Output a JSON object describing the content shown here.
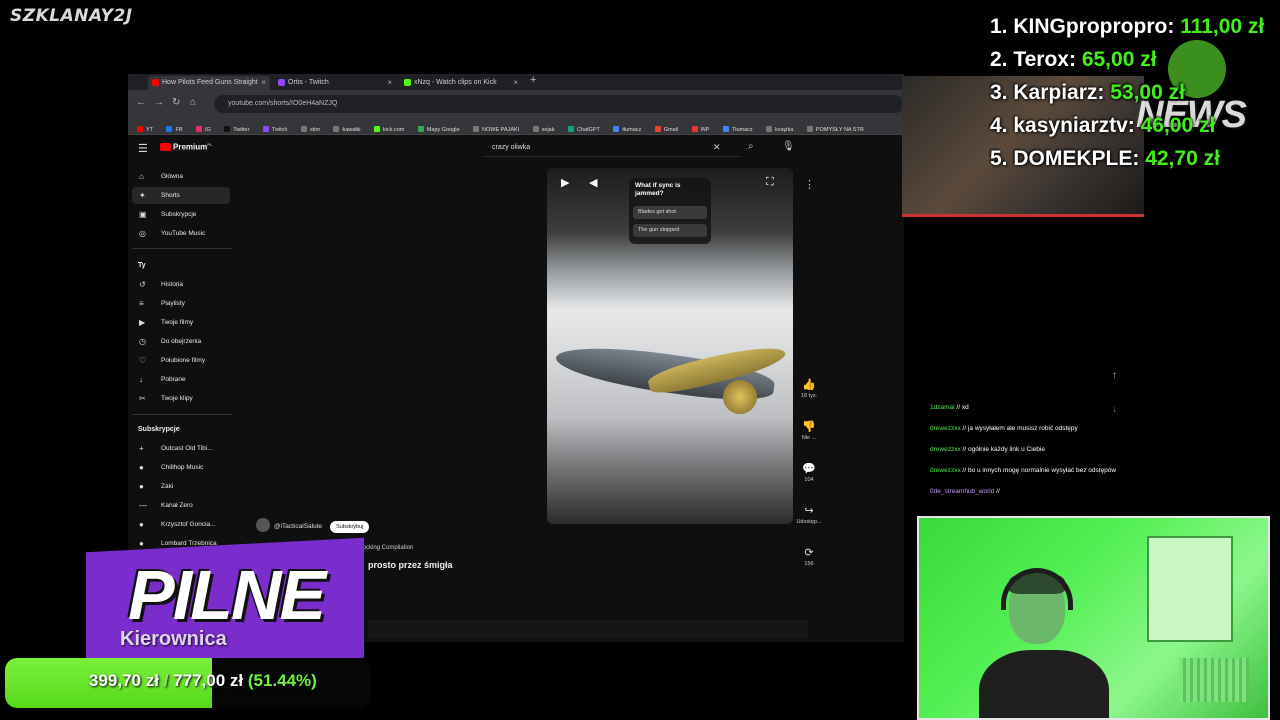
{
  "overlay": {
    "watermark": "SZKLANAY2J",
    "leaderboard": [
      {
        "rank": "1.",
        "name": "KINGpropropro:",
        "amount": "111,00 zł"
      },
      {
        "rank": "2.",
        "name": "Terox:",
        "amount": "65,00 zł"
      },
      {
        "rank": "3.",
        "name": "Karpiarz:",
        "amount": "53,00 zł"
      },
      {
        "rank": "4.",
        "name": "kasyniarztv:",
        "amount": "46,00 zł"
      },
      {
        "rank": "5.",
        "name": "DOMEKPLE:",
        "amount": "42,70 zł"
      }
    ],
    "news_logo": "NEWS",
    "breaking_label": "PILNE",
    "breaking_sub": "Kierownica",
    "goal": {
      "current": "399,70 zł",
      "separator": "/",
      "target": "777,00 zł",
      "percent_text": "(51.44%)",
      "fraction": 0.5144
    },
    "accent": "#42f01a",
    "purple": "#7b2ccd"
  },
  "browser": {
    "tabs": [
      {
        "title": "How Pilots Feed Guns Straight",
        "color": "#ff0000"
      },
      {
        "title": "Ortis - Twitch",
        "color": "#9146ff"
      },
      {
        "title": "xNzq - Watch clips on Kick",
        "color": "#53fc18"
      }
    ],
    "url": "youtube.com/shorts/IO0eH4aNZJQ",
    "bookmarks": [
      "YT",
      "FB",
      "IG",
      "Twitter",
      "Twitch",
      "stim",
      "kawałki",
      "kick.com",
      "Mapy Google",
      "NOWE PAJAKI",
      "sejak",
      "ChatGPT",
      "tłumacz",
      "Gmail",
      "WP",
      "Tłumacz",
      "książka",
      "POMYSŁY NA STR"
    ]
  },
  "youtube": {
    "brand": "Premium",
    "brand_sup": "PL",
    "nav": [
      {
        "label": "Główna",
        "icon": "home-icon"
      },
      {
        "label": "Shorts",
        "icon": "shorts-icon"
      },
      {
        "label": "Subskrypcje",
        "icon": "subscriptions-icon"
      },
      {
        "label": "YouTube Music",
        "icon": "music-icon"
      }
    ],
    "you_heading": "Ty",
    "you_items": [
      {
        "label": "Historia",
        "icon": "history-icon"
      },
      {
        "label": "Playlisty",
        "icon": "playlist-icon"
      },
      {
        "label": "Twoje filmy",
        "icon": "video-icon"
      },
      {
        "label": "Do obejrzenia",
        "icon": "clock-icon"
      },
      {
        "label": "Polubione filmy",
        "icon": "like-icon"
      },
      {
        "label": "Pobrane",
        "icon": "download-icon"
      },
      {
        "label": "Twoje klipy",
        "icon": "scissors-icon"
      }
    ],
    "subs_heading": "Subskrypcje",
    "subs": [
      "Outcast Old Tibi...",
      "Chillhop Music",
      "Zaki",
      "Kanał Zero",
      "Krzysztof Goncia...",
      "Lombard Trzebnica"
    ],
    "search_value": "crazy oliwka",
    "poll": {
      "question": "What if sync is jammed?",
      "options": [
        "Blades get shot",
        "The gun stopped"
      ]
    },
    "actions": [
      {
        "icon": "thumbs-up-icon",
        "label": "18 tys."
      },
      {
        "icon": "thumbs-down-icon",
        "label": "Nie ..."
      },
      {
        "icon": "comment-icon",
        "label": "104"
      },
      {
        "icon": "share-icon",
        "label": "Udostęp..."
      },
      {
        "icon": "remix-icon",
        "label": "156"
      }
    ],
    "channel": "@iTacticalSalute",
    "subscribe": "Subskrybuj",
    "video_title": "Billion-Dollar Fighter Jet Crashes: Shocking Compilation",
    "caption": "prosto przez śmigła"
  },
  "chat": [
    {
      "user": "1dzamal",
      "sep": "//",
      "text": "xd",
      "purple": false
    },
    {
      "user": "drewezzxx",
      "sep": "//",
      "text": "ja wysyłałem ale musisz robić odstępy",
      "purple": false
    },
    {
      "user": "drewezzxx",
      "sep": "//",
      "text": "ogólnie każdy link u Ciebie",
      "purple": false
    },
    {
      "user": "drewezzxx",
      "sep": "//",
      "text": "bo u innych mogę normalnie wysyłać bez odstępów",
      "purple": false
    },
    {
      "user": "0de_streamhub_world",
      "sep": "//",
      "text": "",
      "purple": true
    }
  ]
}
